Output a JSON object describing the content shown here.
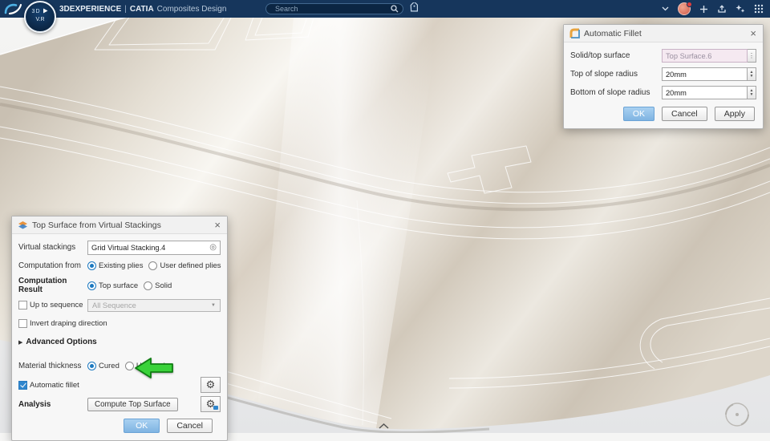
{
  "topbar": {
    "brand": "3DEXPERIENCE",
    "separator": "|",
    "app_name": "CATIA",
    "app_module": "Composites Design",
    "search_placeholder": "Search",
    "compass_3d": "3D",
    "compass_label": "V.R"
  },
  "glyphs": {
    "close": "×",
    "gear": "⚙",
    "spinner_up": "▲",
    "spinner_down": "▼",
    "dropdown": "▼",
    "triangle_right": "▶",
    "dots": "⋮",
    "reticle": "◎"
  },
  "fillet_dialog": {
    "title": "Automatic Fillet",
    "fields": [
      {
        "label": "Solid/top surface",
        "value": "Top Surface.6"
      },
      {
        "label": "Top of slope radius",
        "value": "20mm"
      },
      {
        "label": "Bottom of slope radius",
        "value": "20mm"
      }
    ],
    "buttons": {
      "ok": "OK",
      "cancel": "Cancel",
      "apply": "Apply"
    }
  },
  "stacking_dialog": {
    "title": "Top Surface from Virtual Stackings",
    "rows": {
      "virtual_stackings": {
        "label": "Virtual stackings",
        "value": "Grid Virtual Stacking.4"
      },
      "computation_from": {
        "label": "Computation from",
        "options": [
          "Existing plies",
          "User defined plies"
        ],
        "selected": "Existing plies"
      },
      "computation_result": {
        "label": "Computation Result",
        "options": [
          "Top surface",
          "Solid"
        ],
        "selected": "Top surface"
      },
      "up_to_sequence": {
        "label": "Up to sequence",
        "checked": false,
        "dropdown_value": "All Sequence"
      },
      "invert_draping": {
        "label": "Invert draping direction",
        "checked": false
      },
      "advanced_options": {
        "label": "Advanced Options"
      },
      "material_thickness": {
        "label": "Material thickness",
        "options": [
          "Cured",
          "Uncured"
        ],
        "selected": "Cured"
      },
      "automatic_fillet": {
        "label": "Automatic fillet",
        "checked": true
      },
      "analysis": {
        "label": "Analysis",
        "button": "Compute Top Surface"
      }
    },
    "buttons": {
      "ok": "OK",
      "cancel": "Cancel"
    }
  },
  "colors": {
    "topbar_bg": "#16365c",
    "accent_blue": "#1c79c0",
    "ok_button": "#8dc0ea",
    "surface_beige": "#d9d1c5",
    "annotation_green": "#3ad23a"
  }
}
